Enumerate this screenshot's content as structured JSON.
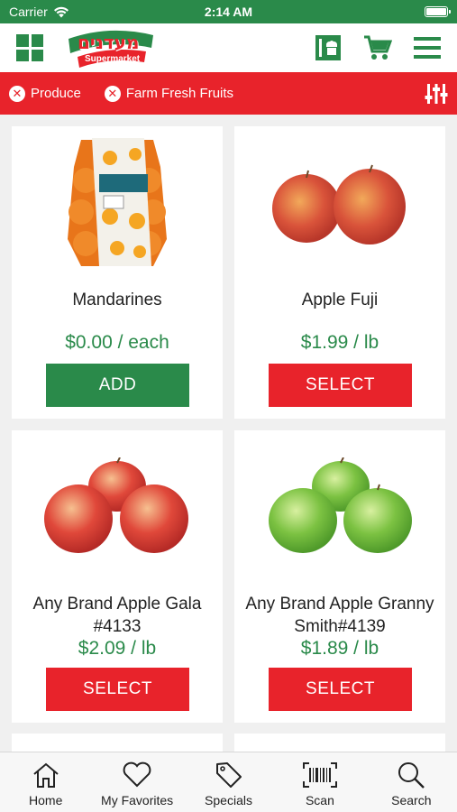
{
  "status_bar": {
    "carrier": "Carrier",
    "time": "2:14 AM"
  },
  "header": {
    "logo_text": "מעדנים",
    "logo_subtext": "Supermarket",
    "icons": [
      "grid-menu-icon",
      "store-card-icon",
      "cart-icon",
      "hamburger-menu-icon"
    ]
  },
  "filters": {
    "chips": [
      {
        "label": "Produce"
      },
      {
        "label": "Farm Fresh Fruits"
      }
    ]
  },
  "products": [
    {
      "name": "Mandarines",
      "price": "$0.00 / each",
      "button": "ADD",
      "button_color": "#2a8a4a"
    },
    {
      "name": "Apple Fuji",
      "price": "$1.99 / lb",
      "button": "SELECT",
      "button_color": "#e8232b"
    },
    {
      "name": "Any Brand Apple Gala #4133",
      "price": "$2.09 / lb",
      "button": "SELECT",
      "button_color": "#e8232b"
    },
    {
      "name": "Any Brand Apple Granny Smith#4139",
      "price": "$1.89 / lb",
      "button": "SELECT",
      "button_color": "#e8232b"
    }
  ],
  "tabs": [
    {
      "label": "Home",
      "icon": "home-icon"
    },
    {
      "label": "My Favorites",
      "icon": "heart-icon"
    },
    {
      "label": "Specials",
      "icon": "tag-icon"
    },
    {
      "label": "Scan",
      "icon": "barcode-icon"
    },
    {
      "label": "Search",
      "icon": "search-icon"
    }
  ],
  "colors": {
    "brand_green": "#2a8a4a",
    "brand_red": "#e8232b",
    "price_green": "#2a8a4a"
  }
}
